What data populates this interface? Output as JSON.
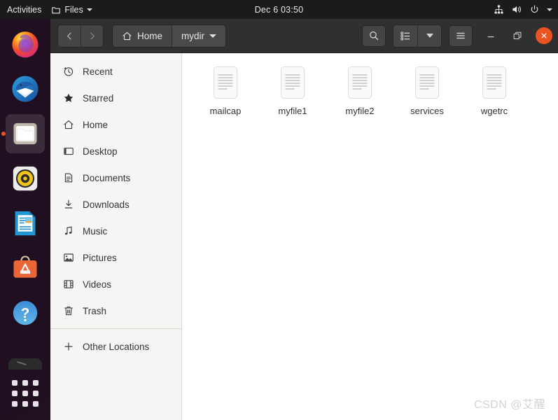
{
  "topbar": {
    "activities": "Activities",
    "app_menu": {
      "label": "Files",
      "icon": "files-app-icon",
      "arrow": "chevron-down-icon"
    },
    "clock": "Dec 6  03:50",
    "tray": [
      {
        "name": "network-wired-icon"
      },
      {
        "name": "volume-icon"
      },
      {
        "name": "power-icon"
      },
      {
        "name": "chevron-down-icon"
      }
    ]
  },
  "dock": {
    "items": [
      {
        "name": "firefox",
        "label": "Firefox",
        "active": false
      },
      {
        "name": "thunderbird",
        "label": "Thunderbird Mail",
        "active": false
      },
      {
        "name": "files",
        "label": "Files",
        "active": true
      },
      {
        "name": "rhythmbox",
        "label": "Rhythmbox",
        "active": false
      },
      {
        "name": "libreoffice-writer",
        "label": "LibreOffice Writer",
        "active": false
      },
      {
        "name": "ubuntu-software",
        "label": "Ubuntu Software",
        "active": false
      },
      {
        "name": "help",
        "label": "Help",
        "active": false
      }
    ],
    "show_apps": "show-applications",
    "accent": "#e95420"
  },
  "window": {
    "title": "Files",
    "nav": {
      "back": "back-icon",
      "forward": "forward-icon"
    },
    "breadcrumb": [
      {
        "label": "Home",
        "icon": "home-icon",
        "current": false
      },
      {
        "label": "mydir",
        "icon": "chevron-down-icon",
        "current": true
      }
    ],
    "toolbar": {
      "search": "search-icon",
      "view_list": "list-view-icon",
      "view_dropdown": "chevron-down-icon",
      "menu": "hamburger-menu-icon"
    },
    "controls": {
      "minimize": "minimize-icon",
      "maximize": "maximize-icon",
      "close": "close-icon",
      "close_color": "#e95420"
    }
  },
  "sidebar": {
    "items": [
      {
        "label": "Recent",
        "icon": "clock-icon"
      },
      {
        "label": "Starred",
        "icon": "star-icon"
      },
      {
        "label": "Home",
        "icon": "home-icon"
      },
      {
        "label": "Desktop",
        "icon": "desktop-icon"
      },
      {
        "label": "Documents",
        "icon": "documents-icon"
      },
      {
        "label": "Downloads",
        "icon": "download-icon"
      },
      {
        "label": "Music",
        "icon": "music-note-icon"
      },
      {
        "label": "Pictures",
        "icon": "picture-icon"
      },
      {
        "label": "Videos",
        "icon": "video-icon"
      },
      {
        "label": "Trash",
        "icon": "trash-icon"
      }
    ],
    "other_locations": {
      "label": "Other Locations",
      "icon": "plus-icon"
    }
  },
  "files": [
    {
      "name": "mailcap",
      "icon": "text-file-icon"
    },
    {
      "name": "myfile1",
      "icon": "text-file-icon"
    },
    {
      "name": "myfile2",
      "icon": "text-file-icon"
    },
    {
      "name": "services",
      "icon": "text-file-icon"
    },
    {
      "name": "wgetrc",
      "icon": "text-file-icon"
    }
  ],
  "watermark": "CSDN @艾醒"
}
